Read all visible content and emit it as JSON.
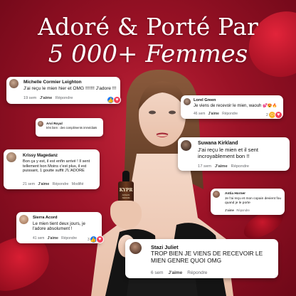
{
  "headline": {
    "line1": "Adoré & Porté Par",
    "line2": "5 000+ Femmes"
  },
  "product": {
    "brand": "KYPR",
    "sub": "ARGAN SÉRUM"
  },
  "comments": [
    {
      "name": "Michelle Cormier Leighton",
      "text": "J'ai reçu le mien hier et OMG !!!!!!! J'adore !!!",
      "time": "19 sem",
      "like": "J'aime",
      "reply": "Répondre"
    },
    {
      "name": "Lorel Green",
      "text": "Je viens de recevoir le mien, waouh",
      "time": "46 sem",
      "like": "J'aime",
      "reply": "Répondre",
      "count": "2"
    },
    {
      "name": "Arvi Royal",
      "text": "très bien : des compliments immédiats",
      "time": "",
      "like": "",
      "reply": ""
    },
    {
      "name": "Suwana Kirkland",
      "text": "J'ai reçu le mien et il sent incroyablement bon !!",
      "time": "17 sem",
      "like": "J'aime",
      "reply": "Répondre"
    },
    {
      "name": "Krissy Magedanz",
      "text": "Bon ça y est, il est enfin arrivé ! Il sent tellement bon Moins c'est plus, il est puissant, 1 goutte suffit J'L'ADORE",
      "time": "21 sem",
      "like": "J'aime",
      "reply": "Répondre",
      "edited": "Modifié"
    },
    {
      "name": "Antia Horner",
      "text": "Je l'ai reçu et mon copain devient fou quand je le porte",
      "time": "",
      "like": "J'aime",
      "reply": "Répondre"
    },
    {
      "name": "Sierra Acord",
      "text": "Le mien tient deux jours, je l'adore absolument !",
      "time": "41 sem",
      "like": "J'aime",
      "reply": "Répondre",
      "count": "3"
    },
    {
      "name": "Stazi Juliet",
      "text": "TROP BIEN JE VIENS DE RECEVOIR LE MIEN GENRE QUOI OMG",
      "time": "6 sem",
      "like": "J'aime",
      "reply": "Répondre"
    }
  ],
  "colors": {
    "background": "#9a1226",
    "like": "#1877f2",
    "love": "#f33e58",
    "haha": "#f7b125"
  }
}
